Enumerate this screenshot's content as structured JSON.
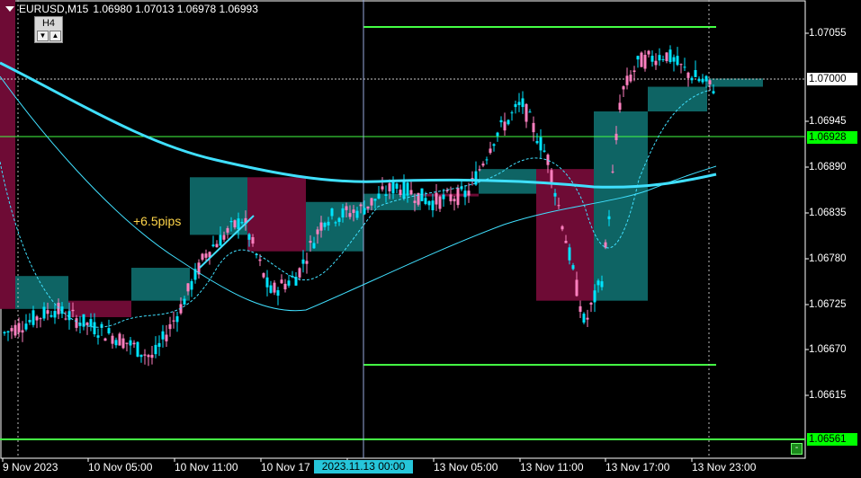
{
  "header": {
    "symbol": "EURUSD,M15",
    "ohlc": "1.06980 1.07013 1.06978 1.06993"
  },
  "timeframe_box": {
    "label": "H4",
    "down_glyph": "▼",
    "up_glyph": "▲"
  },
  "price_axis": {
    "labels": [
      "1.07055",
      "1.06945",
      "1.06890",
      "1.06835",
      "1.06780",
      "1.06725",
      "1.06670",
      "1.06615"
    ],
    "tags": [
      {
        "text": "1.07000",
        "bg": "#ffffff",
        "fg": "#000000"
      },
      {
        "text": "1.06928",
        "bg": "#00ff00",
        "fg": "#000000"
      },
      {
        "text": "1.06561",
        "bg": "#00ff00",
        "fg": "#000000"
      }
    ]
  },
  "time_axis": {
    "labels": [
      "9 Nov 2023",
      "10 Nov 05:00",
      "10 Nov 11:00",
      "10 Nov 17",
      "13 Nov 05:00",
      "13 Nov 11:00",
      "13 Nov 17:00",
      "13 Nov 23:00"
    ],
    "cursor_label": "2023.11.13 00:00"
  },
  "annotation": {
    "pips": "+6.5pips"
  },
  "corner_button": {
    "glyph": "-"
  },
  "colors": {
    "bull": "#00e5ff",
    "bear": "#ff80c0",
    "htf_bull": "#0e6464",
    "htf_bear": "#6e0b35",
    "ma_slow": "#40e0ff",
    "level": "#44ff44"
  }
}
